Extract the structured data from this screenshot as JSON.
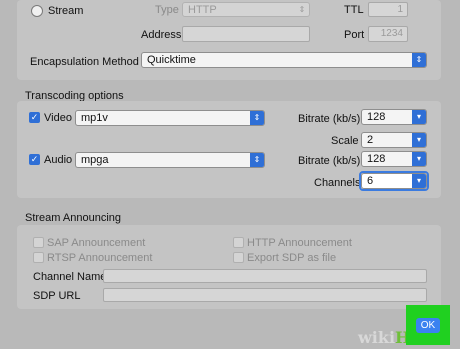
{
  "stream": {
    "radio_label": "Stream",
    "type_label": "Type",
    "type_value": "HTTP",
    "ttl_label": "TTL",
    "ttl_value": "1",
    "address_label": "Address",
    "address_value": "",
    "port_label": "Port",
    "port_value": "1234",
    "encapsulation_label": "Encapsulation Method",
    "encapsulation_value": "Quicktime"
  },
  "transcoding": {
    "title": "Transcoding options",
    "video_label": "Video",
    "video_checked": true,
    "video_codec": "mp1v",
    "video_bitrate_label": "Bitrate (kb/s)",
    "video_bitrate": "128",
    "scale_label": "Scale",
    "scale_value": "2",
    "audio_label": "Audio",
    "audio_checked": true,
    "audio_codec": "mpga",
    "audio_bitrate_label": "Bitrate (kb/s)",
    "audio_bitrate": "128",
    "channels_label": "Channels",
    "channels_value": "6"
  },
  "announcing": {
    "title": "Stream Announcing",
    "sap_label": "SAP Announcement",
    "rtsp_label": "RTSP Announcement",
    "http_label": "HTTP Announcement",
    "export_sdp_label": "Export SDP as file",
    "channel_name_label": "Channel Name",
    "channel_name_value": "",
    "sdp_url_label": "SDP URL",
    "sdp_url_value": ""
  },
  "footer": {
    "ok_label": "OK",
    "watermark_wiki": "wiki",
    "watermark_how": "How"
  },
  "colors": {
    "accent": "#2f6fd6",
    "highlight": "#20d020",
    "background": "#b9b9b9"
  }
}
